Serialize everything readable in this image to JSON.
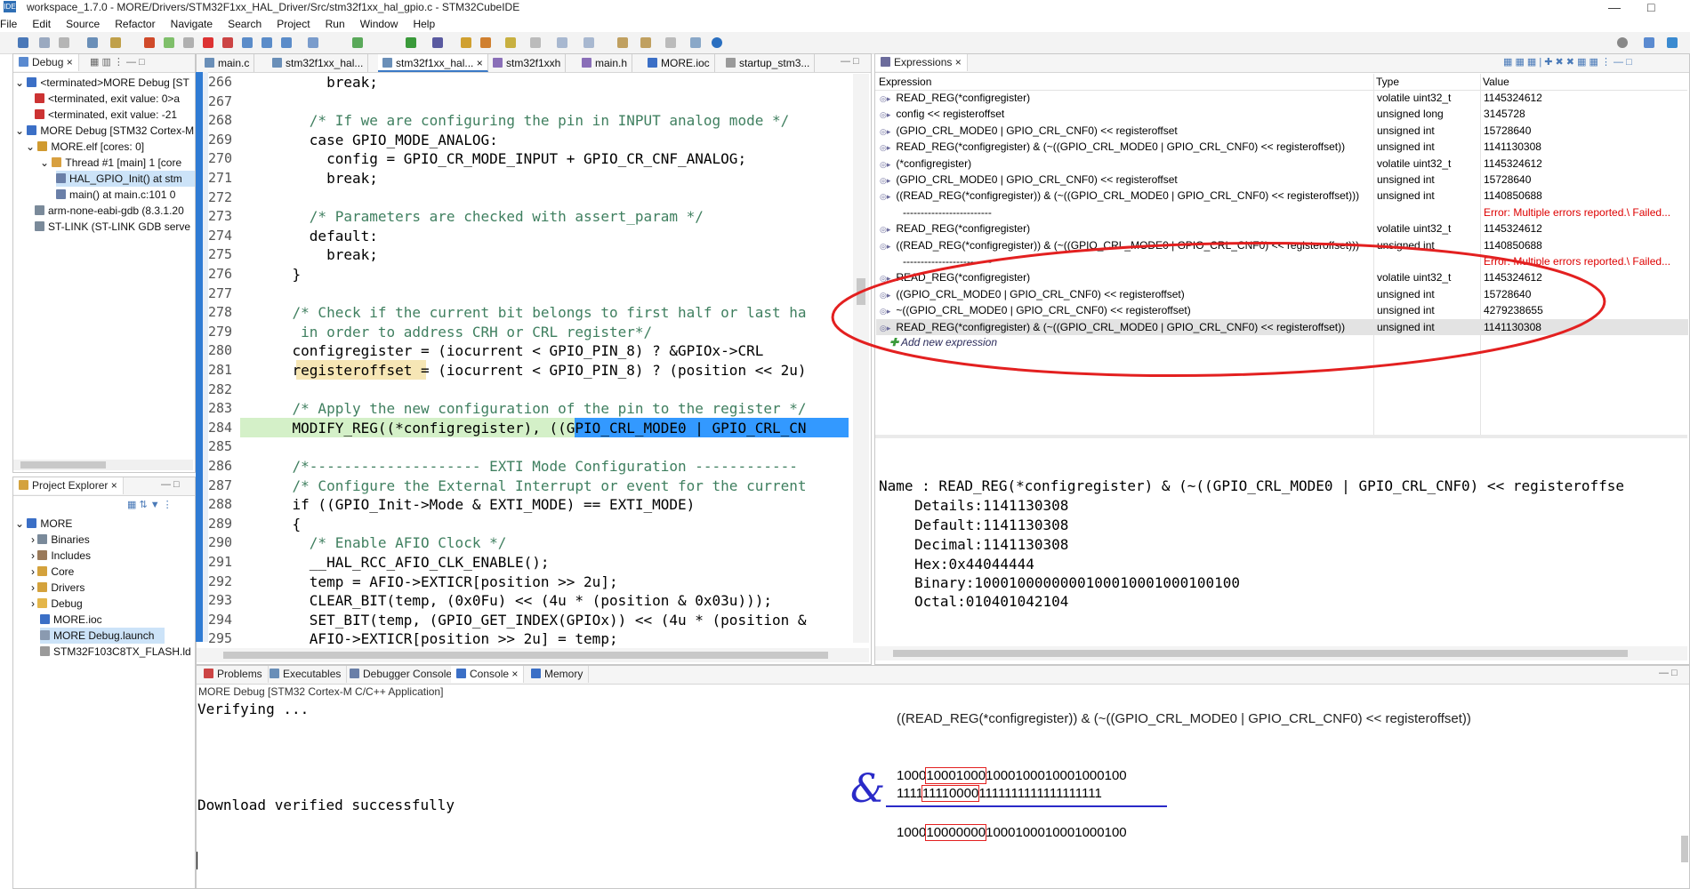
{
  "window": {
    "title": "workspace_1.7.0 - MORE/Drivers/STM32F1xx_HAL_Driver/Src/stm32f1xx_hal_gpio.c - STM32CubeIDE",
    "app_icon": "ide-icon"
  },
  "menu": [
    "File",
    "Edit",
    "Source",
    "Refactor",
    "Navigate",
    "Search",
    "Project",
    "Run",
    "Window",
    "Help"
  ],
  "debug_view": {
    "tab_label": "Debug",
    "items": [
      {
        "label": "<terminated>MORE Debug [ST",
        "icon": "terminated-launch-icon"
      },
      {
        "label": "<terminated, exit value: 0>a",
        "icon": "terminated-process-icon"
      },
      {
        "label": "<terminated, exit value: -21",
        "icon": "terminated-process-icon"
      },
      {
        "label": "MORE Debug [STM32 Cortex-M",
        "icon": "launch-icon"
      },
      {
        "label": "MORE.elf [cores: 0]",
        "icon": "elf-icon"
      },
      {
        "label": "Thread #1 [main] 1 [core",
        "icon": "thread-icon"
      },
      {
        "label": "HAL_GPIO_Init() at stm",
        "icon": "stack-frame-icon"
      },
      {
        "label": "main() at main.c:101 0",
        "icon": "stack-frame-icon"
      },
      {
        "label": "arm-none-eabi-gdb (8.3.1.20",
        "icon": "gdb-icon"
      },
      {
        "label": "ST-LINK (ST-LINK GDB serve",
        "icon": "stlink-icon"
      }
    ]
  },
  "project_explorer": {
    "tab_label": "Project Explorer",
    "items": [
      {
        "label": "MORE",
        "icon": "project-icon"
      },
      {
        "label": "Binaries",
        "icon": "binaries-icon"
      },
      {
        "label": "Includes",
        "icon": "includes-icon"
      },
      {
        "label": "Core",
        "icon": "folder-icon"
      },
      {
        "label": "Drivers",
        "icon": "folder-icon"
      },
      {
        "label": "Debug",
        "icon": "folder-icon"
      },
      {
        "label": "MORE.ioc",
        "icon": "ioc-file-icon"
      },
      {
        "label": "MORE Debug.launch",
        "icon": "launch-file-icon"
      },
      {
        "label": "STM32F103C8TX_FLASH.ld",
        "icon": "ld-file-icon"
      }
    ]
  },
  "editor": {
    "tabs": [
      "main.c",
      "stm32f1xx_hal...",
      "stm32f1xx_hal...",
      "stm32f1xxh",
      "main.h",
      "MORE.ioc",
      "startup_stm3..."
    ],
    "lines": [
      {
        "n": "266",
        "code": "        break;"
      },
      {
        "n": "267",
        "code": ""
      },
      {
        "n": "268",
        "code": "      /* If we are configuring the pin in INPUT analog mode */"
      },
      {
        "n": "269",
        "code": "      case GPIO_MODE_ANALOG:"
      },
      {
        "n": "270",
        "code": "        config = GPIO_CR_MODE_INPUT + GPIO_CR_CNF_ANALOG;"
      },
      {
        "n": "271",
        "code": "        break;"
      },
      {
        "n": "272",
        "code": ""
      },
      {
        "n": "273",
        "code": "      /* Parameters are checked with assert_param */"
      },
      {
        "n": "274",
        "code": "      default:"
      },
      {
        "n": "275",
        "code": "        break;"
      },
      {
        "n": "276",
        "code": "    }"
      },
      {
        "n": "277",
        "code": ""
      },
      {
        "n": "278",
        "code": "    /* Check if the current bit belongs to first half or last ha"
      },
      {
        "n": "279",
        "code": "     in order to address CRH or CRL register*/"
      },
      {
        "n": "280",
        "code": "    configregister = (iocurrent < GPIO_PIN_8) ? &GPIOx->CRL"
      },
      {
        "n": "281",
        "code": "    registeroffset = (iocurrent < GPIO_PIN_8) ? (position << 2u)"
      },
      {
        "n": "282",
        "code": ""
      },
      {
        "n": "283",
        "code": "    /* Apply the new configuration of the pin to the register */"
      },
      {
        "n": "284",
        "code": "    MODIFY_REG((*configregister), ((GPIO_CRL_MODE0 | GPIO_CRL_CN"
      },
      {
        "n": "285",
        "code": ""
      },
      {
        "n": "286",
        "code": "    /*-------------------- EXTI Mode Configuration ------------"
      },
      {
        "n": "287",
        "code": "    /* Configure the External Interrupt or event for the current"
      },
      {
        "n": "288",
        "code": "    if ((GPIO_Init->Mode & EXTI_MODE) == EXTI_MODE)"
      },
      {
        "n": "289",
        "code": "    {"
      },
      {
        "n": "290",
        "code": "      /* Enable AFIO Clock */"
      },
      {
        "n": "291",
        "code": "      __HAL_RCC_AFIO_CLK_ENABLE();"
      },
      {
        "n": "292",
        "code": "      temp = AFIO->EXTICR[position >> 2u];"
      },
      {
        "n": "293",
        "code": "      CLEAR_BIT(temp, (0x0Fu) << (4u * (position & 0x03u)));"
      },
      {
        "n": "294",
        "code": "      SET_BIT(temp, (GPIO_GET_INDEX(GPIOx)) << (4u * (position &"
      },
      {
        "n": "295",
        "code": "      AFIO->EXTICR[position >> 2u] = temp;"
      }
    ]
  },
  "expressions": {
    "tab_label": "Expressions",
    "columns": [
      "Expression",
      "Type",
      "Value"
    ],
    "rows": [
      {
        "expr": "READ_REG(*configregister)",
        "type": "volatile uint32_t",
        "value": "1145324612"
      },
      {
        "expr": "config << registeroffset",
        "type": "unsigned long",
        "value": "3145728"
      },
      {
        "expr": "(GPIO_CRL_MODE0 | GPIO_CRL_CNF0) << registeroffset",
        "type": "unsigned int",
        "value": "15728640"
      },
      {
        "expr": "READ_REG(*configregister) & (~((GPIO_CRL_MODE0 | GPIO_CRL_CNF0) << registeroffset))",
        "type": "unsigned int",
        "value": "1141130308"
      },
      {
        "expr": "(*configregister)",
        "type": "volatile uint32_t",
        "value": "1145324612"
      },
      {
        "expr": "(GPIO_CRL_MODE0 | GPIO_CRL_CNF0) << registeroffset",
        "type": "unsigned int",
        "value": "15728640"
      },
      {
        "expr": "((READ_REG(*configregister)) & (~((GPIO_CRL_MODE0 | GPIO_CRL_CNF0) << registeroffset)))",
        "type": "unsigned int",
        "value": "1140850688"
      },
      {
        "expr": "-------------------------",
        "type": "",
        "value": "Error: Multiple errors reported.\\ Failed..."
      },
      {
        "expr": "READ_REG(*configregister)",
        "type": "volatile uint32_t",
        "value": "1145324612"
      },
      {
        "expr": "((READ_REG(*configregister)) & (~((GPIO_CRL_MODE0 | GPIO_CRL_CNF0) << registeroffset)))",
        "type": "unsigned int",
        "value": "1140850688"
      },
      {
        "expr": "-------------------------",
        "type": "",
        "value": "Error: Multiple errors reported.\\ Failed..."
      },
      {
        "expr": "READ_REG(*configregister)",
        "type": "volatile uint32_t",
        "value": "1145324612"
      },
      {
        "expr": "((GPIO_CRL_MODE0 | GPIO_CRL_CNF0) << registeroffset)",
        "type": "unsigned int",
        "value": "15728640"
      },
      {
        "expr": "~((GPIO_CRL_MODE0 | GPIO_CRL_CNF0) << registeroffset)",
        "type": "unsigned int",
        "value": "4279238655"
      },
      {
        "expr": "READ_REG(*configregister) & (~((GPIO_CRL_MODE0 | GPIO_CRL_CNF0) << registeroffset))",
        "type": "unsigned int",
        "value": "1141130308"
      }
    ],
    "add_new": "Add new expression",
    "details": {
      "name": "Name : READ_REG(*configregister) & (~((GPIO_CRL_MODE0 | GPIO_CRL_CNF0) << registeroffse",
      "details": "Details:1141130308",
      "default": "Default:1141130308",
      "decimal": "Decimal:1141130308",
      "hex": "Hex:0x44044444",
      "binary": "Binary:1000100000000100010001000100100",
      "octal": "Octal:010401042104"
    }
  },
  "bottom_tabs": [
    "Problems",
    "Executables",
    "Debugger Console",
    "Console",
    "Memory"
  ],
  "console": {
    "header": "MORE Debug [STM32 Cortex-M C/C++ Application]",
    "line1": "Verifying ...",
    "line2": "Download verified successfully"
  },
  "annotation": {
    "expression": "((READ_REG(*configregister)) & (~((GPIO_CRL_MODE0 | GPIO_CRL_CNF0) << registeroffset))",
    "bin1": [
      "1000",
      "10001000",
      "1000100010001000100"
    ],
    "bin2": [
      "1111",
      "11110000",
      "1111111111111111111"
    ],
    "result": [
      "1000",
      "10000000",
      "1000100010001000100"
    ],
    "and_symbol": "&",
    "circle_color": "#e32020",
    "line_color": "#2a2ac8"
  }
}
